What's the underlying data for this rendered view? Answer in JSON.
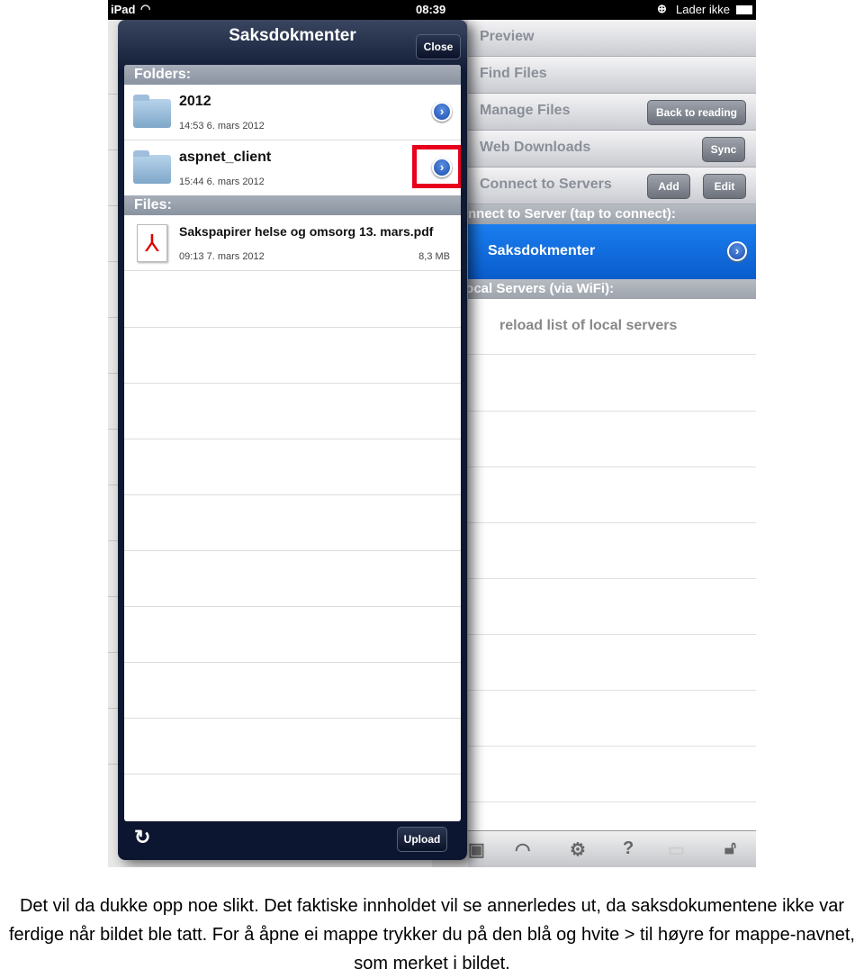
{
  "status_bar": {
    "device": "iPad",
    "time": "08:39",
    "charging": "Lader ikke"
  },
  "menu": {
    "items": [
      {
        "label": "Preview"
      },
      {
        "label": "Find Files"
      },
      {
        "label": "Manage Files",
        "button": "Back to reading"
      },
      {
        "label": "Web Downloads",
        "button": "Sync"
      },
      {
        "label": "Connect to Servers",
        "add": "Add",
        "edit": "Edit"
      }
    ],
    "section_connect": "Connect to Server (tap to connect):",
    "server": "Saksdokmenter",
    "section_local": "Local Servers (via WiFi):",
    "reload": "reload list of local servers",
    "highlight_color": "#0a64d8"
  },
  "toolbar_icons": [
    "camera-icon",
    "wifi-icon",
    "gear-icon",
    "help-icon",
    "monitor-icon",
    "unlock-icon"
  ],
  "popover": {
    "title": "Saksdokmenter",
    "close": "Close",
    "folders_header": "Folders:",
    "folders": [
      {
        "name": "2012",
        "date": "14:53 6. mars 2012"
      },
      {
        "name": "aspnet_client",
        "date": "15:44 6. mars 2012"
      }
    ],
    "files_header": "Files:",
    "files": [
      {
        "name": "Sakspapirer helse og omsorg 13. mars.pdf",
        "date": "09:13 7. mars 2012",
        "size": "8,3 MB"
      }
    ],
    "upload": "Upload",
    "highlight_marker_color": "#e8001c"
  },
  "caption": "Det vil da dukke opp noe slikt. Det faktiske innholdet vil se annerledes ut, da saksdokumentene ikke var ferdige når bildet ble tatt. For å åpne ei mappe trykker du på den blå og hvite > til høyre for mappe-navnet, som merket i bildet."
}
